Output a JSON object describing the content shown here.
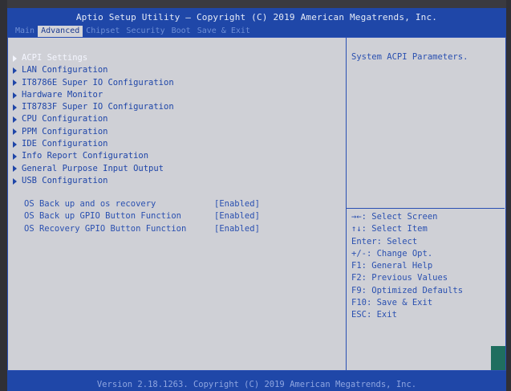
{
  "header": {
    "title": "Aptio Setup Utility – Copyright (C) 2019 American Megatrends, Inc.",
    "tabs": [
      "Main",
      "Advanced",
      "Chipset",
      "Security",
      "Boot",
      "Save & Exit"
    ],
    "active_tab": "Advanced"
  },
  "menu": {
    "items": [
      "ACPI Settings",
      "LAN Configuration",
      "IT8786E Super IO Configuration",
      "Hardware Monitor",
      "IT8783F Super IO Configuration",
      "CPU Configuration",
      "PPM Configuration",
      "IDE Configuration",
      "Info Report Configuration",
      "General Purpose Input Output",
      "USB Configuration"
    ],
    "selected": "ACPI Settings"
  },
  "options": [
    {
      "label": "OS Back up and os recovery",
      "value": "[Enabled]"
    },
    {
      "label": "OS Back up GPIO Button Function",
      "value": "[Enabled]"
    },
    {
      "label": "OS Recovery GPIO Button Function",
      "value": "[Enabled]"
    }
  ],
  "help": {
    "description": "System ACPI Parameters.",
    "keys": [
      "→←: Select Screen",
      "↑↓: Select Item",
      "Enter: Select",
      "+/-: Change Opt.",
      "F1: General Help",
      "F2: Previous Values",
      "F9: Optimized Defaults",
      "F10: Save & Exit",
      "ESC: Exit"
    ]
  },
  "footer": {
    "version": "Version 2.18.1263. Copyright (C) 2019 American Megatrends, Inc."
  },
  "colors": {
    "header_blue": "#1f47a8",
    "panel_gray": "#cfd0d6",
    "text_blue": "#1e45a8"
  }
}
